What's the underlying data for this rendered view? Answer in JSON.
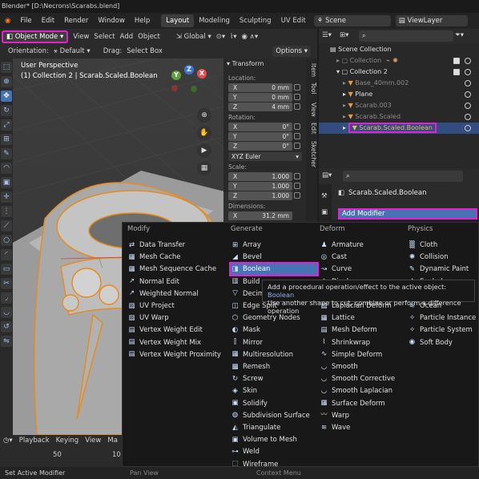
{
  "titlebar": {
    "text": "Blender* [D:\\Necrons\\Scarabs.blend]"
  },
  "menus": [
    "File",
    "Edit",
    "Render",
    "Window",
    "Help"
  ],
  "workspaces": [
    "Layout",
    "Modeling",
    "Sculpting",
    "UV Edit"
  ],
  "scene": {
    "label": "Scene"
  },
  "viewlayer": {
    "label": "ViewLayer"
  },
  "viewport_header": {
    "mode": "Object Mode",
    "items": [
      "View",
      "Select",
      "Add",
      "Object"
    ],
    "transform": "Global"
  },
  "viewport_header2": {
    "orientation_label": "Orientation:",
    "orientation": "Default",
    "drag_label": "Drag:",
    "drag": "Select Box",
    "options": "Options"
  },
  "viewport": {
    "perspective": "User Perspective",
    "collection": "(1) Collection 2 | Scarab.Scaled.Boolean"
  },
  "gizmo": {
    "x": "X",
    "y": "Y",
    "z": "Z"
  },
  "npanel": {
    "section": "Transform",
    "location_label": "Location:",
    "location": [
      {
        "ax": "X",
        "v": "0 mm"
      },
      {
        "ax": "Y",
        "v": "0 mm"
      },
      {
        "ax": "Z",
        "v": "4 mm"
      }
    ],
    "rotation_label": "Rotation:",
    "rotation": [
      {
        "ax": "X",
        "v": "0°"
      },
      {
        "ax": "Y",
        "v": "0°"
      },
      {
        "ax": "Z",
        "v": "0°"
      }
    ],
    "euler": "XYZ Euler",
    "scale_label": "Scale:",
    "scale": [
      {
        "ax": "X",
        "v": "1.000"
      },
      {
        "ax": "Y",
        "v": "1.000"
      },
      {
        "ax": "Z",
        "v": "1.000"
      }
    ],
    "dimensions_label": "Dimensions:",
    "dim_x": {
      "ax": "X",
      "v": "31.2 mm"
    },
    "tabs": [
      "Item",
      "Tool",
      "View",
      "Edit",
      "Sketcher"
    ]
  },
  "outliner": {
    "rows": [
      {
        "label": "Scene Collection",
        "indent": 0
      },
      {
        "label": "Collection",
        "indent": 1
      },
      {
        "label": "Collection 2",
        "indent": 1
      },
      {
        "label": "Base_40mm.002",
        "indent": 2
      },
      {
        "label": "Plane",
        "indent": 2
      },
      {
        "label": "Scarab.003",
        "indent": 2
      },
      {
        "label": "Scarab.Scaled",
        "indent": 2
      },
      {
        "label": "Scarab.Scaled.Boolean",
        "indent": 2
      }
    ]
  },
  "properties": {
    "object": "Scarab.Scaled.Boolean",
    "add_modifier": "Add Modifier"
  },
  "modifier_menu": {
    "columns": [
      "Modify",
      "Generate",
      "Deform",
      "Physics"
    ],
    "modify": [
      "Data Transfer",
      "Mesh Cache",
      "Mesh Sequence Cache",
      "Normal Edit",
      "Weighted Normal",
      "UV Project",
      "UV Warp",
      "Vertex Weight Edit",
      "Vertex Weight Mix",
      "Vertex Weight Proximity"
    ],
    "generate": [
      "Array",
      "Bevel",
      "Boolean",
      "Build",
      "Decimate",
      "Edge Split",
      "Geometry Nodes",
      "Mask",
      "Mirror",
      "Multiresolution",
      "Remesh",
      "Screw",
      "Skin",
      "Solidify",
      "Subdivision Surface",
      "Triangulate",
      "Volume to Mesh",
      "Weld",
      "Wireframe"
    ],
    "deform": [
      "Armature",
      "Cast",
      "Curve",
      "Displace",
      "Hook",
      "Laplacian Deform",
      "Lattice",
      "Mesh Deform",
      "Shrinkwrap",
      "Simple Deform",
      "Smooth",
      "Smooth Corrective",
      "Smooth Laplacian",
      "Surface Deform",
      "Warp",
      "Wave"
    ],
    "physics": [
      "Cloth",
      "Collision",
      "Dynamic Paint",
      "Explode",
      "Fluid",
      "Ocean",
      "Particle Instance",
      "Particle System",
      "Soft Body"
    ]
  },
  "tooltip": {
    "line1": "Add a procedural operation/effect to the active object:",
    "name": "Boolean",
    "line2": "Use another shape to cut, combine or perform a difference operation"
  },
  "timeline": {
    "menus": [
      "Playback",
      "Keying",
      "View",
      "Ma"
    ],
    "frame_a": "50",
    "frame_b": "10"
  },
  "statusbar": {
    "left": "Set Active Modifier",
    "mid1": "Pan View",
    "mid2": "Context Menu"
  },
  "colors": {
    "accent": "#4772b3",
    "highlight": "#e022d0",
    "selected_row": "#334d80"
  }
}
